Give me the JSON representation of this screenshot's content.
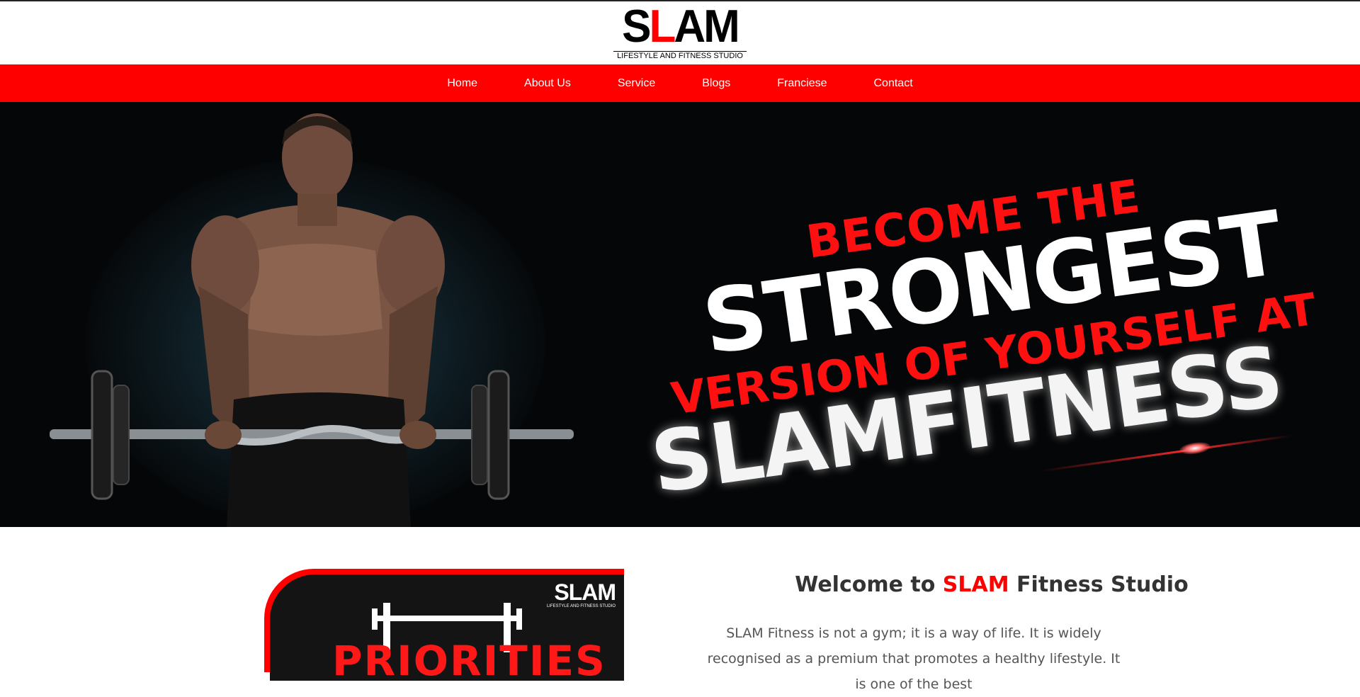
{
  "logo": {
    "word_start": "S",
    "word_accent": "L",
    "word_end": "AM",
    "tagline": "LIFESTYLE AND FITNESS STUDIO"
  },
  "nav": {
    "items": [
      {
        "label": "Home"
      },
      {
        "label": "About Us"
      },
      {
        "label": "Service"
      },
      {
        "label": "Blogs"
      },
      {
        "label": "Franciese"
      },
      {
        "label": "Contact"
      }
    ]
  },
  "hero": {
    "line1": "BECOME THE",
    "line2": "STRONGEST",
    "line3": "VERSION OF YOURSELF AT",
    "line4": "SLAMFITNESS"
  },
  "feature_card": {
    "logo_word": "SLAM",
    "logo_tagline": "LIFESTYLE AND FITNESS STUDIO",
    "title": "PRIORITIES"
  },
  "welcome": {
    "prefix": "Welcome to",
    "brand": "SLAM",
    "suffix": "Fitness Studio"
  },
  "intro": {
    "text": "SLAM Fitness is not a gym; it is a way of life. It is widely recognised as a premium that promotes a healthy lifestyle. It is one of the best"
  },
  "colors": {
    "accent": "#ff0000",
    "hero_bg": "#050607",
    "text": "#333333"
  }
}
